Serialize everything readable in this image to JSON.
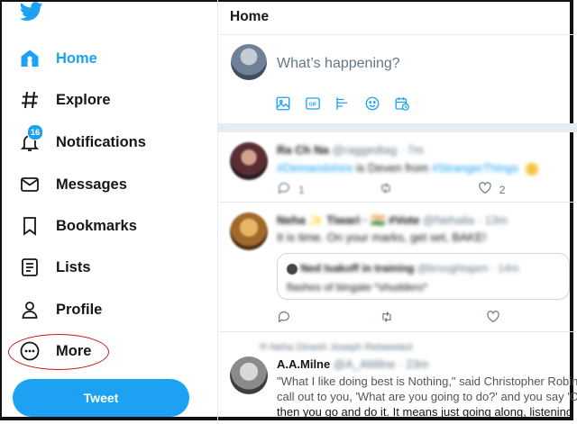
{
  "sidebar": {
    "items": [
      {
        "label": "Home",
        "icon": "home-icon"
      },
      {
        "label": "Explore",
        "icon": "hashtag-icon"
      },
      {
        "label": "Notifications",
        "icon": "bell-icon",
        "badge": "16"
      },
      {
        "label": "Messages",
        "icon": "envelope-icon"
      },
      {
        "label": "Bookmarks",
        "icon": "bookmark-icon"
      },
      {
        "label": "Lists",
        "icon": "list-icon"
      },
      {
        "label": "Profile",
        "icon": "person-icon"
      },
      {
        "label": "More",
        "icon": "more-icon"
      }
    ],
    "tweet_button": "Tweet"
  },
  "main": {
    "title": "Home",
    "compose_placeholder": "What’s happening?",
    "compose_tools": [
      "image-icon",
      "gif-icon",
      "poll-icon",
      "emoji-icon",
      "schedule-icon"
    ],
    "tweets": [
      {
        "name": "Ra Ch Na",
        "handle": "@raggedtag · 7m",
        "text_tag1": "#Demandshire",
        "text_mid": " is Deven from ",
        "text_tag2": "#StrangerThings",
        "replies": "1",
        "likes": "2"
      },
      {
        "name": "Neha ✨ Tiwari · 🇮🇳 #Vote",
        "handle": "@Nehalia · 13m",
        "text": "It is time. On your marks, get set, BAKE!",
        "quote_name": "Ned Isakoff in training",
        "quote_handle": "@brought­ajam · 14m",
        "quote_text": "flashes of bingate *shudders*"
      },
      {
        "retweeted_by": "Neha Dinesh Joseph Retweeted",
        "name": "A.A.Milne",
        "handle": "@A_AMilne · 23m",
        "line1": "\"What I like doing best is Nothing,\" said Christopher Robin.",
        "line2": "call out to you, 'What are you going to do?' and you say 'O",
        "line3": "then you go and do it. It means just going along, listening"
      }
    ]
  },
  "colors": {
    "accent": "#1da1f2",
    "annotation": "#d0151b"
  }
}
